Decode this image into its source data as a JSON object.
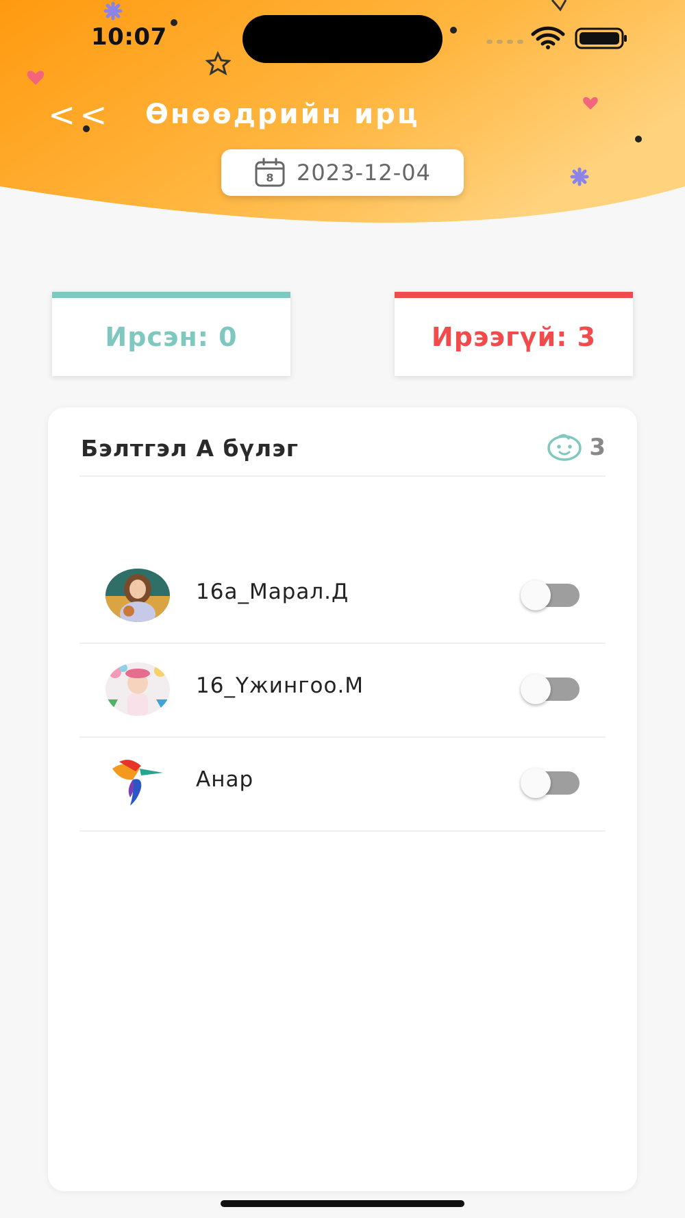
{
  "status_bar": {
    "time": "10:07"
  },
  "header": {
    "back_label": "<<",
    "title": "Өнөөдрийн ирц",
    "date": "2023-12-04",
    "calendar_day": "8"
  },
  "stats": {
    "present_label": "Ирсэн: 0",
    "absent_label": "Ирээгүй: 3"
  },
  "group": {
    "name": "Бэлтгэл А бүлэг",
    "count": "3"
  },
  "students": [
    {
      "name": "16а_Марал.Д",
      "present": false,
      "avatar": "photo-girl-icon"
    },
    {
      "name": "16_Үжингоо.М",
      "present": false,
      "avatar": "photo-girl-balloons-icon"
    },
    {
      "name": "Анар",
      "present": false,
      "avatar": "hummingbird-logo-icon"
    }
  ],
  "colors": {
    "header_orange": "#ffa51f",
    "present": "#7ec8c0",
    "absent": "#f24b4b"
  }
}
